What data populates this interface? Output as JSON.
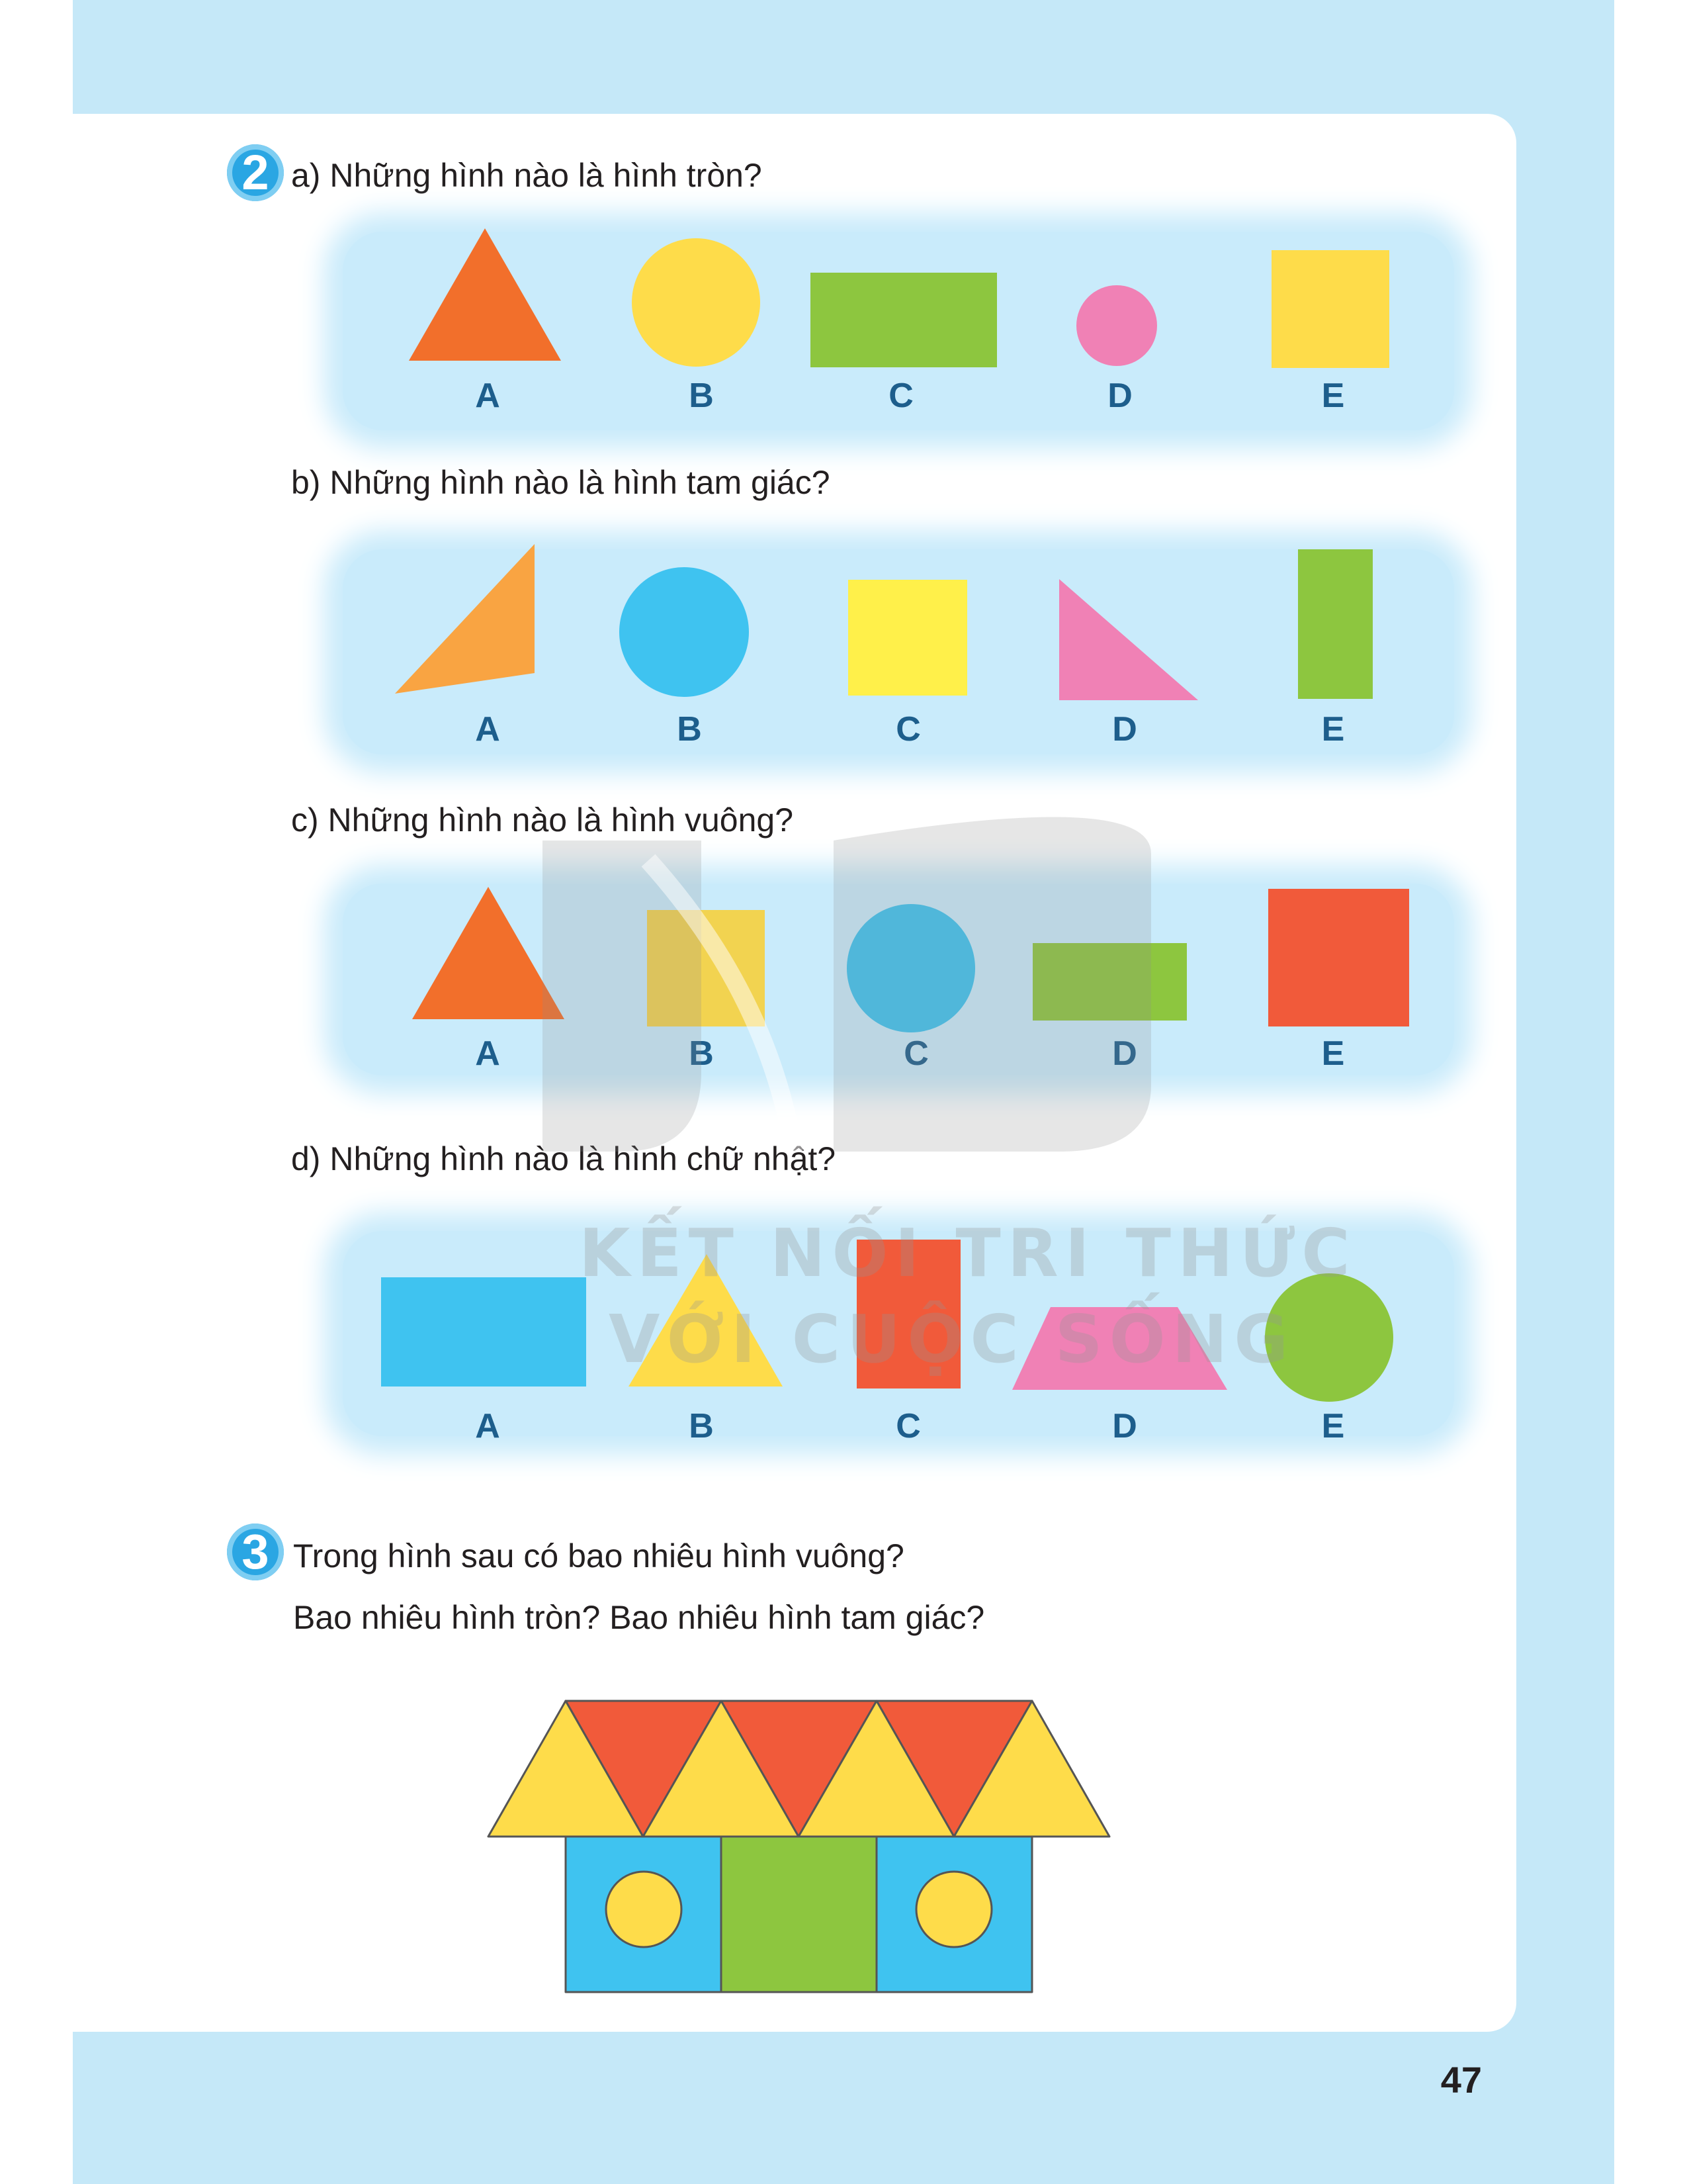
{
  "exercise2": {
    "number": "2",
    "parts": [
      {
        "question": "a) Những hình nào là hình tròn?",
        "labels": [
          "A",
          "B",
          "C",
          "D",
          "E"
        ]
      },
      {
        "question": "b) Những hình nào là hình tam giác?",
        "labels": [
          "A",
          "B",
          "C",
          "D",
          "E"
        ]
      },
      {
        "question": "c) Những hình nào là hình vuông?",
        "labels": [
          "A",
          "B",
          "C",
          "D",
          "E"
        ]
      },
      {
        "question": "d) Những hình nào là hình chữ nhật?",
        "labels": [
          "A",
          "B",
          "C",
          "D",
          "E"
        ]
      }
    ]
  },
  "exercise3": {
    "number": "3",
    "line1": "Trong hình sau có bao nhiêu hình vuông?",
    "line2": "Bao nhiêu hình tròn? Bao nhiêu hình tam giác?"
  },
  "watermark": {
    "line1": "KẾT NỐI TRI THỨC",
    "line2": "VỚI CUỘC SỐNG"
  },
  "page_number": "47",
  "colors": {
    "frame": "#c5e8f8",
    "orange": "#f26f2b",
    "yellow": "#fedc4a",
    "green": "#8dc63f",
    "pink": "#f081b5",
    "blue": "#3fc3f0",
    "red": "#f15a3a",
    "badge": "#2aa6e3"
  }
}
